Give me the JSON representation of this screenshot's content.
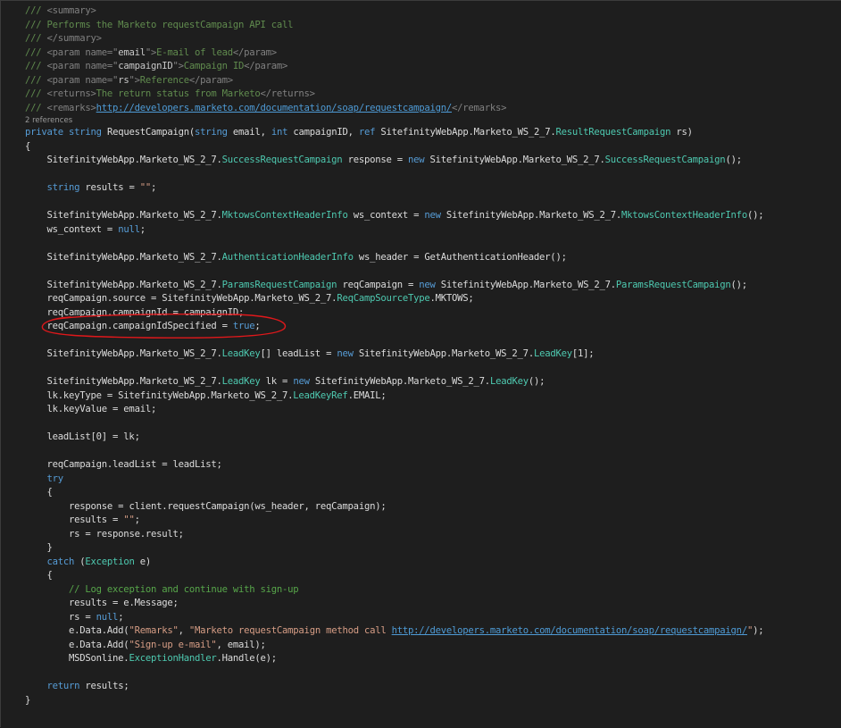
{
  "editor": {
    "codelens_text": "2 references",
    "highlight_color": "#e0181b",
    "colors": {
      "background": "#1e1e1e",
      "plain": "#dcdcdc",
      "keyword": "#569cd6",
      "type": "#4ec9b0",
      "string": "#d69d85",
      "comment": "#57a64a",
      "link": "#4e9bd6"
    },
    "lines": [
      {
        "indent": 0,
        "tokens": [
          [
            "docmark",
            "/// "
          ],
          [
            "doctag",
            "<summary>"
          ]
        ]
      },
      {
        "indent": 0,
        "tokens": [
          [
            "docmark",
            "/// Performs the Marketo requestCampaign API call"
          ]
        ]
      },
      {
        "indent": 0,
        "tokens": [
          [
            "docmark",
            "/// "
          ],
          [
            "doctag",
            "</summary>"
          ]
        ]
      },
      {
        "indent": 0,
        "tokens": [
          [
            "docmark",
            "/// "
          ],
          [
            "doctag",
            "<param name=\""
          ],
          [
            "docattr",
            "email"
          ],
          [
            "doctag",
            "\">"
          ],
          [
            "docmark",
            "E-mail of lead"
          ],
          [
            "doctag",
            "</param>"
          ]
        ]
      },
      {
        "indent": 0,
        "tokens": [
          [
            "docmark",
            "/// "
          ],
          [
            "doctag",
            "<param name=\""
          ],
          [
            "docattr",
            "campaignID"
          ],
          [
            "doctag",
            "\">"
          ],
          [
            "docmark",
            "Campaign ID"
          ],
          [
            "doctag",
            "</param>"
          ]
        ]
      },
      {
        "indent": 0,
        "tokens": [
          [
            "docmark",
            "/// "
          ],
          [
            "doctag",
            "<param name=\""
          ],
          [
            "docattr",
            "rs"
          ],
          [
            "doctag",
            "\">"
          ],
          [
            "docmark",
            "Reference"
          ],
          [
            "doctag",
            "</param>"
          ]
        ]
      },
      {
        "indent": 0,
        "tokens": [
          [
            "docmark",
            "/// "
          ],
          [
            "doctag",
            "<returns>"
          ],
          [
            "docmark",
            "The return status from Marketo"
          ],
          [
            "doctag",
            "</returns>"
          ]
        ]
      },
      {
        "indent": 0,
        "tokens": [
          [
            "docmark",
            "/// "
          ],
          [
            "doctag",
            "<remarks>"
          ],
          [
            "link",
            "http://developers.marketo.com/documentation/soap/requestcampaign/"
          ],
          [
            "doctag",
            "</remarks>"
          ]
        ]
      },
      {
        "codelens": true
      },
      {
        "indent": 0,
        "tokens": [
          [
            "kw",
            "private"
          ],
          [
            "plain",
            " "
          ],
          [
            "kw",
            "string"
          ],
          [
            "plain",
            " RequestCampaign("
          ],
          [
            "kw",
            "string"
          ],
          [
            "plain",
            " email, "
          ],
          [
            "kw",
            "int"
          ],
          [
            "plain",
            " campaignID, "
          ],
          [
            "kw",
            "ref"
          ],
          [
            "plain",
            " SitefinityWebApp.Marketo_WS_2_7."
          ],
          [
            "type",
            "ResultRequestCampaign"
          ],
          [
            "plain",
            " rs)"
          ]
        ]
      },
      {
        "indent": 0,
        "tokens": [
          [
            "plain",
            "{"
          ]
        ]
      },
      {
        "indent": 1,
        "tokens": [
          [
            "plain",
            "SitefinityWebApp.Marketo_WS_2_7."
          ],
          [
            "type",
            "SuccessRequestCampaign"
          ],
          [
            "plain",
            " response = "
          ],
          [
            "kw",
            "new"
          ],
          [
            "plain",
            " SitefinityWebApp.Marketo_WS_2_7."
          ],
          [
            "type",
            "SuccessRequestCampaign"
          ],
          [
            "plain",
            "();"
          ]
        ]
      },
      {
        "indent": 0,
        "tokens": []
      },
      {
        "indent": 1,
        "tokens": [
          [
            "kw",
            "string"
          ],
          [
            "plain",
            " results = "
          ],
          [
            "str",
            "\"\""
          ],
          [
            "plain",
            ";"
          ]
        ]
      },
      {
        "indent": 0,
        "tokens": []
      },
      {
        "indent": 1,
        "tokens": [
          [
            "plain",
            "SitefinityWebApp.Marketo_WS_2_7."
          ],
          [
            "type",
            "MktowsContextHeaderInfo"
          ],
          [
            "plain",
            " ws_context = "
          ],
          [
            "kw",
            "new"
          ],
          [
            "plain",
            " SitefinityWebApp.Marketo_WS_2_7."
          ],
          [
            "type",
            "MktowsContextHeaderInfo"
          ],
          [
            "plain",
            "();"
          ]
        ]
      },
      {
        "indent": 1,
        "tokens": [
          [
            "plain",
            "ws_context = "
          ],
          [
            "kw",
            "null"
          ],
          [
            "plain",
            ";"
          ]
        ]
      },
      {
        "indent": 0,
        "tokens": []
      },
      {
        "indent": 1,
        "tokens": [
          [
            "plain",
            "SitefinityWebApp.Marketo_WS_2_7."
          ],
          [
            "type",
            "AuthenticationHeaderInfo"
          ],
          [
            "plain",
            " ws_header = GetAuthenticationHeader();"
          ]
        ]
      },
      {
        "indent": 0,
        "tokens": []
      },
      {
        "indent": 1,
        "tokens": [
          [
            "plain",
            "SitefinityWebApp.Marketo_WS_2_7."
          ],
          [
            "type",
            "ParamsRequestCampaign"
          ],
          [
            "plain",
            " reqCampaign = "
          ],
          [
            "kw",
            "new"
          ],
          [
            "plain",
            " SitefinityWebApp.Marketo_WS_2_7."
          ],
          [
            "type",
            "ParamsRequestCampaign"
          ],
          [
            "plain",
            "();"
          ]
        ]
      },
      {
        "indent": 1,
        "tokens": [
          [
            "plain",
            "reqCampaign.source = SitefinityWebApp.Marketo_WS_2_7."
          ],
          [
            "type",
            "ReqCampSourceType"
          ],
          [
            "plain",
            ".MKTOWS;"
          ]
        ]
      },
      {
        "indent": 1,
        "tokens": [
          [
            "plain",
            "reqCampaign.campaignId = campaignID;"
          ]
        ]
      },
      {
        "indent": 1,
        "highlighted": true,
        "tokens": [
          [
            "plain",
            "reqCampaign.campaignIdSpecified = "
          ],
          [
            "kw",
            "true"
          ],
          [
            "plain",
            ";"
          ]
        ]
      },
      {
        "indent": 0,
        "tokens": []
      },
      {
        "indent": 1,
        "tokens": [
          [
            "plain",
            "SitefinityWebApp.Marketo_WS_2_7."
          ],
          [
            "type",
            "LeadKey"
          ],
          [
            "plain",
            "[] leadList = "
          ],
          [
            "kw",
            "new"
          ],
          [
            "plain",
            " SitefinityWebApp.Marketo_WS_2_7."
          ],
          [
            "type",
            "LeadKey"
          ],
          [
            "plain",
            "[1];"
          ]
        ]
      },
      {
        "indent": 0,
        "tokens": []
      },
      {
        "indent": 1,
        "tokens": [
          [
            "plain",
            "SitefinityWebApp.Marketo_WS_2_7."
          ],
          [
            "type",
            "LeadKey"
          ],
          [
            "plain",
            " lk = "
          ],
          [
            "kw",
            "new"
          ],
          [
            "plain",
            " SitefinityWebApp.Marketo_WS_2_7."
          ],
          [
            "type",
            "LeadKey"
          ],
          [
            "plain",
            "();"
          ]
        ]
      },
      {
        "indent": 1,
        "tokens": [
          [
            "plain",
            "lk.keyType = SitefinityWebApp.Marketo_WS_2_7."
          ],
          [
            "type",
            "LeadKeyRef"
          ],
          [
            "plain",
            ".EMAIL;"
          ]
        ]
      },
      {
        "indent": 1,
        "tokens": [
          [
            "plain",
            "lk.keyValue = email;"
          ]
        ]
      },
      {
        "indent": 0,
        "tokens": []
      },
      {
        "indent": 1,
        "tokens": [
          [
            "plain",
            "leadList[0] = lk;"
          ]
        ]
      },
      {
        "indent": 0,
        "tokens": []
      },
      {
        "indent": 1,
        "tokens": [
          [
            "plain",
            "reqCampaign.leadList = leadList;"
          ]
        ]
      },
      {
        "indent": 1,
        "tokens": [
          [
            "kw",
            "try"
          ]
        ]
      },
      {
        "indent": 1,
        "tokens": [
          [
            "plain",
            "{"
          ]
        ]
      },
      {
        "indent": 2,
        "tokens": [
          [
            "plain",
            "response = client.requestCampaign(ws_header, reqCampaign);"
          ]
        ]
      },
      {
        "indent": 2,
        "tokens": [
          [
            "plain",
            "results = "
          ],
          [
            "str",
            "\"\""
          ],
          [
            "plain",
            ";"
          ]
        ]
      },
      {
        "indent": 2,
        "tokens": [
          [
            "plain",
            "rs = response.result;"
          ]
        ]
      },
      {
        "indent": 1,
        "tokens": [
          [
            "plain",
            "}"
          ]
        ]
      },
      {
        "indent": 1,
        "tokens": [
          [
            "kw",
            "catch"
          ],
          [
            "plain",
            " ("
          ],
          [
            "type",
            "Exception"
          ],
          [
            "plain",
            " e)"
          ]
        ]
      },
      {
        "indent": 1,
        "tokens": [
          [
            "plain",
            "{"
          ]
        ]
      },
      {
        "indent": 2,
        "tokens": [
          [
            "cmt",
            "// Log exception and continue with sign-up"
          ]
        ]
      },
      {
        "indent": 2,
        "tokens": [
          [
            "plain",
            "results = e.Message;"
          ]
        ]
      },
      {
        "indent": 2,
        "tokens": [
          [
            "plain",
            "rs = "
          ],
          [
            "kw",
            "null"
          ],
          [
            "plain",
            ";"
          ]
        ]
      },
      {
        "indent": 2,
        "tokens": [
          [
            "plain",
            "e.Data.Add("
          ],
          [
            "str",
            "\"Remarks\""
          ],
          [
            "plain",
            ", "
          ],
          [
            "str",
            "\"Marketo requestCampaign method call "
          ],
          [
            "link",
            "http://developers.marketo.com/documentation/soap/requestcampaign/"
          ],
          [
            "str",
            "\""
          ],
          [
            "plain",
            ");"
          ]
        ]
      },
      {
        "indent": 2,
        "tokens": [
          [
            "plain",
            "e.Data.Add("
          ],
          [
            "str",
            "\"Sign-up e-mail\""
          ],
          [
            "plain",
            ", email);"
          ]
        ]
      },
      {
        "indent": 2,
        "tokens": [
          [
            "plain",
            "MSDSonline."
          ],
          [
            "type",
            "ExceptionHandler"
          ],
          [
            "plain",
            ".Handle(e);"
          ]
        ]
      },
      {
        "indent": 0,
        "tokens": []
      },
      {
        "indent": 1,
        "tokens": [
          [
            "kw",
            "return"
          ],
          [
            "plain",
            " results;"
          ]
        ]
      },
      {
        "indent": 0,
        "tokens": [
          [
            "plain",
            "}"
          ]
        ]
      }
    ]
  }
}
